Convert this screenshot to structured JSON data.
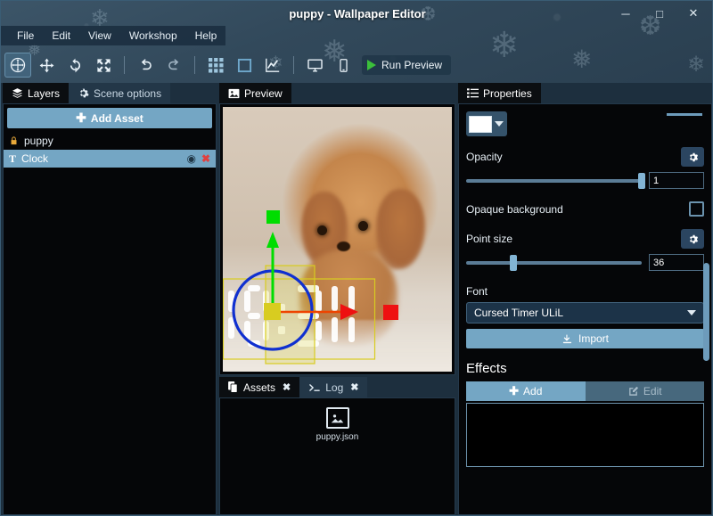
{
  "window": {
    "title": "puppy - Wallpaper Editor",
    "minimize_label": "─",
    "maximize_label": "□",
    "close_label": "✕"
  },
  "menu": {
    "items": [
      {
        "label": "File"
      },
      {
        "label": "Edit"
      },
      {
        "label": "View"
      },
      {
        "label": "Workshop"
      },
      {
        "label": "Help"
      }
    ]
  },
  "toolbar": {
    "tools": [
      {
        "name": "gizmo-select-tool",
        "glyph": "✥",
        "active": true
      },
      {
        "name": "move-tool",
        "glyph": "✥",
        "active": false
      },
      {
        "name": "rotate-tool",
        "glyph": "⟳",
        "active": false
      },
      {
        "name": "scale-tool",
        "glyph": "⤢",
        "active": false
      }
    ],
    "undo_glyph": "↶",
    "redo_glyph": "↷",
    "grid_glyph": "▦",
    "bounds_glyph": "□",
    "graph_glyph": "↗",
    "monitor_glyph": "▭",
    "mobile_glyph": "▯",
    "run_preview_label": "Run Preview"
  },
  "left_panel": {
    "tabs": [
      {
        "label": "Layers",
        "icon": "layers-icon",
        "active": true
      },
      {
        "label": "Scene options",
        "icon": "gear-icon",
        "active": false
      }
    ],
    "add_asset_label": "Add Asset",
    "layers": [
      {
        "name": "puppy",
        "icon": "lock-icon",
        "selected": false,
        "has_controls": false
      },
      {
        "name": "Clock",
        "icon": "text-icon",
        "selected": true,
        "has_controls": true
      }
    ],
    "eye_glyph": "◉",
    "remove_glyph": "✖"
  },
  "center_panel": {
    "preview_tab": {
      "label": "Preview",
      "icon": "image-icon",
      "active": true
    },
    "bottom_tabs": [
      {
        "label": "Assets",
        "icon": "files-icon",
        "active": true,
        "closable": true
      },
      {
        "label": "Log",
        "icon": "terminal-icon",
        "active": false,
        "closable": true
      }
    ],
    "close_glyph": "✖",
    "assets": [
      {
        "label": "puppy.json",
        "icon": "image-file-icon"
      }
    ],
    "gizmo": {
      "y_axis_color": "#00dd00",
      "x_axis_color": "#ee1111",
      "rotation_ring_color": "#1030d0",
      "bounds_color": "#d8cc20",
      "center_handle_color": "#d8cc20"
    },
    "clock_text": "10:34"
  },
  "right_panel": {
    "tab": {
      "label": "Properties",
      "icon": "list-icon",
      "active": true
    },
    "color": {
      "label": "color-swatch",
      "value": "#ffffff",
      "dropdown_glyph": "▼"
    },
    "opacity": {
      "label": "Opacity",
      "value": "1",
      "slider_percent": 100,
      "gear_glyph": "⚙"
    },
    "opaque_background": {
      "label": "Opaque background",
      "checked": false
    },
    "point_size": {
      "label": "Point size",
      "value": "36",
      "slider_percent": 27,
      "gear_glyph": "⚙"
    },
    "font": {
      "label": "Font",
      "value": "Cursed Timer ULiL",
      "caret_glyph": "▼"
    },
    "import": {
      "label": "Import",
      "icon": "import-icon"
    },
    "effects": {
      "heading": "Effects",
      "add_label": "Add",
      "edit_label": "Edit",
      "edit_disabled": true,
      "items": []
    }
  },
  "colors": {
    "accent": "#74a6c4",
    "panel_bg": "#050608",
    "chrome_bg": "#32495b",
    "active_tab_bg": "#0b0e11",
    "slider_fill": "#82b4d4"
  }
}
